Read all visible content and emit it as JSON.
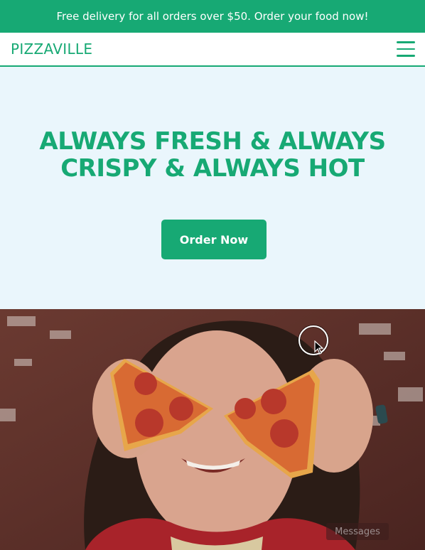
{
  "promo": {
    "text": "Free delivery for all orders over $50. Order your food now!"
  },
  "nav": {
    "logo": "PIZZAVILLE",
    "menu_icon": "hamburger-menu-icon"
  },
  "hero": {
    "title_line1": "ALWAYS FRESH & ALWAYS",
    "title_line2": "CRISPY & ALWAYS HOT",
    "cta_label": "Order Now"
  },
  "chat": {
    "label": "Messages"
  },
  "colors": {
    "accent": "#17a974",
    "hero_bg": "#eaf6fc",
    "white": "#ffffff"
  }
}
